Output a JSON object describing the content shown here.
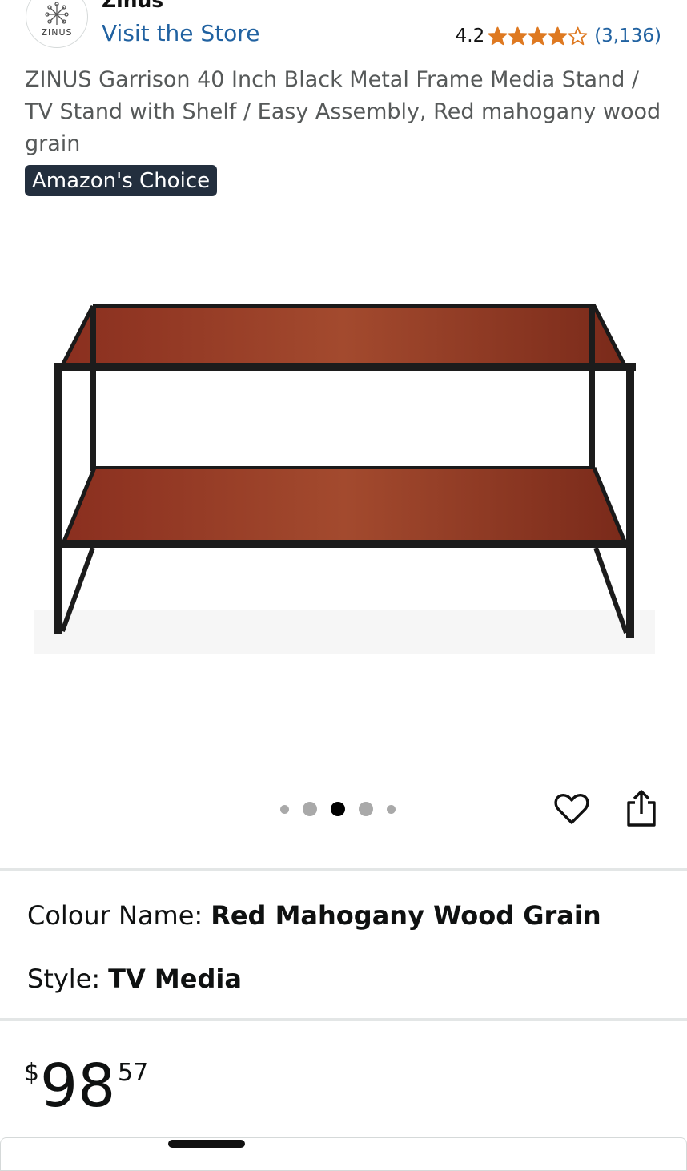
{
  "store": {
    "logo_text": "ZINUS",
    "brand_name": "Zinus",
    "visit_label": "Visit the Store"
  },
  "rating": {
    "value": "4.2",
    "stars_filled": 4,
    "stars_total": 5,
    "count": "(3,136)",
    "star_color": "#de7921"
  },
  "product": {
    "title": "ZINUS Garrison 40 Inch Black Metal Frame Media Stand / TV Stand with Shelf / Easy Assembly, Red mahogany wood grain",
    "badge": "Amazon's Choice"
  },
  "gallery": {
    "image_count": 5,
    "active_index": 2,
    "image_icon": "tv-stand-image"
  },
  "actions": {
    "wishlist_icon": "heart-icon",
    "share_icon": "share-icon"
  },
  "variants": {
    "colour_label": "Colour Name:",
    "colour_value": "Red Mahogany Wood Grain",
    "style_label": "Style:",
    "style_value": "TV Media"
  },
  "price": {
    "currency": "$",
    "whole": "98",
    "fraction": "57"
  },
  "colors": {
    "link": "#2162a1",
    "badge_bg": "#232f3e",
    "star": "#de7921"
  }
}
